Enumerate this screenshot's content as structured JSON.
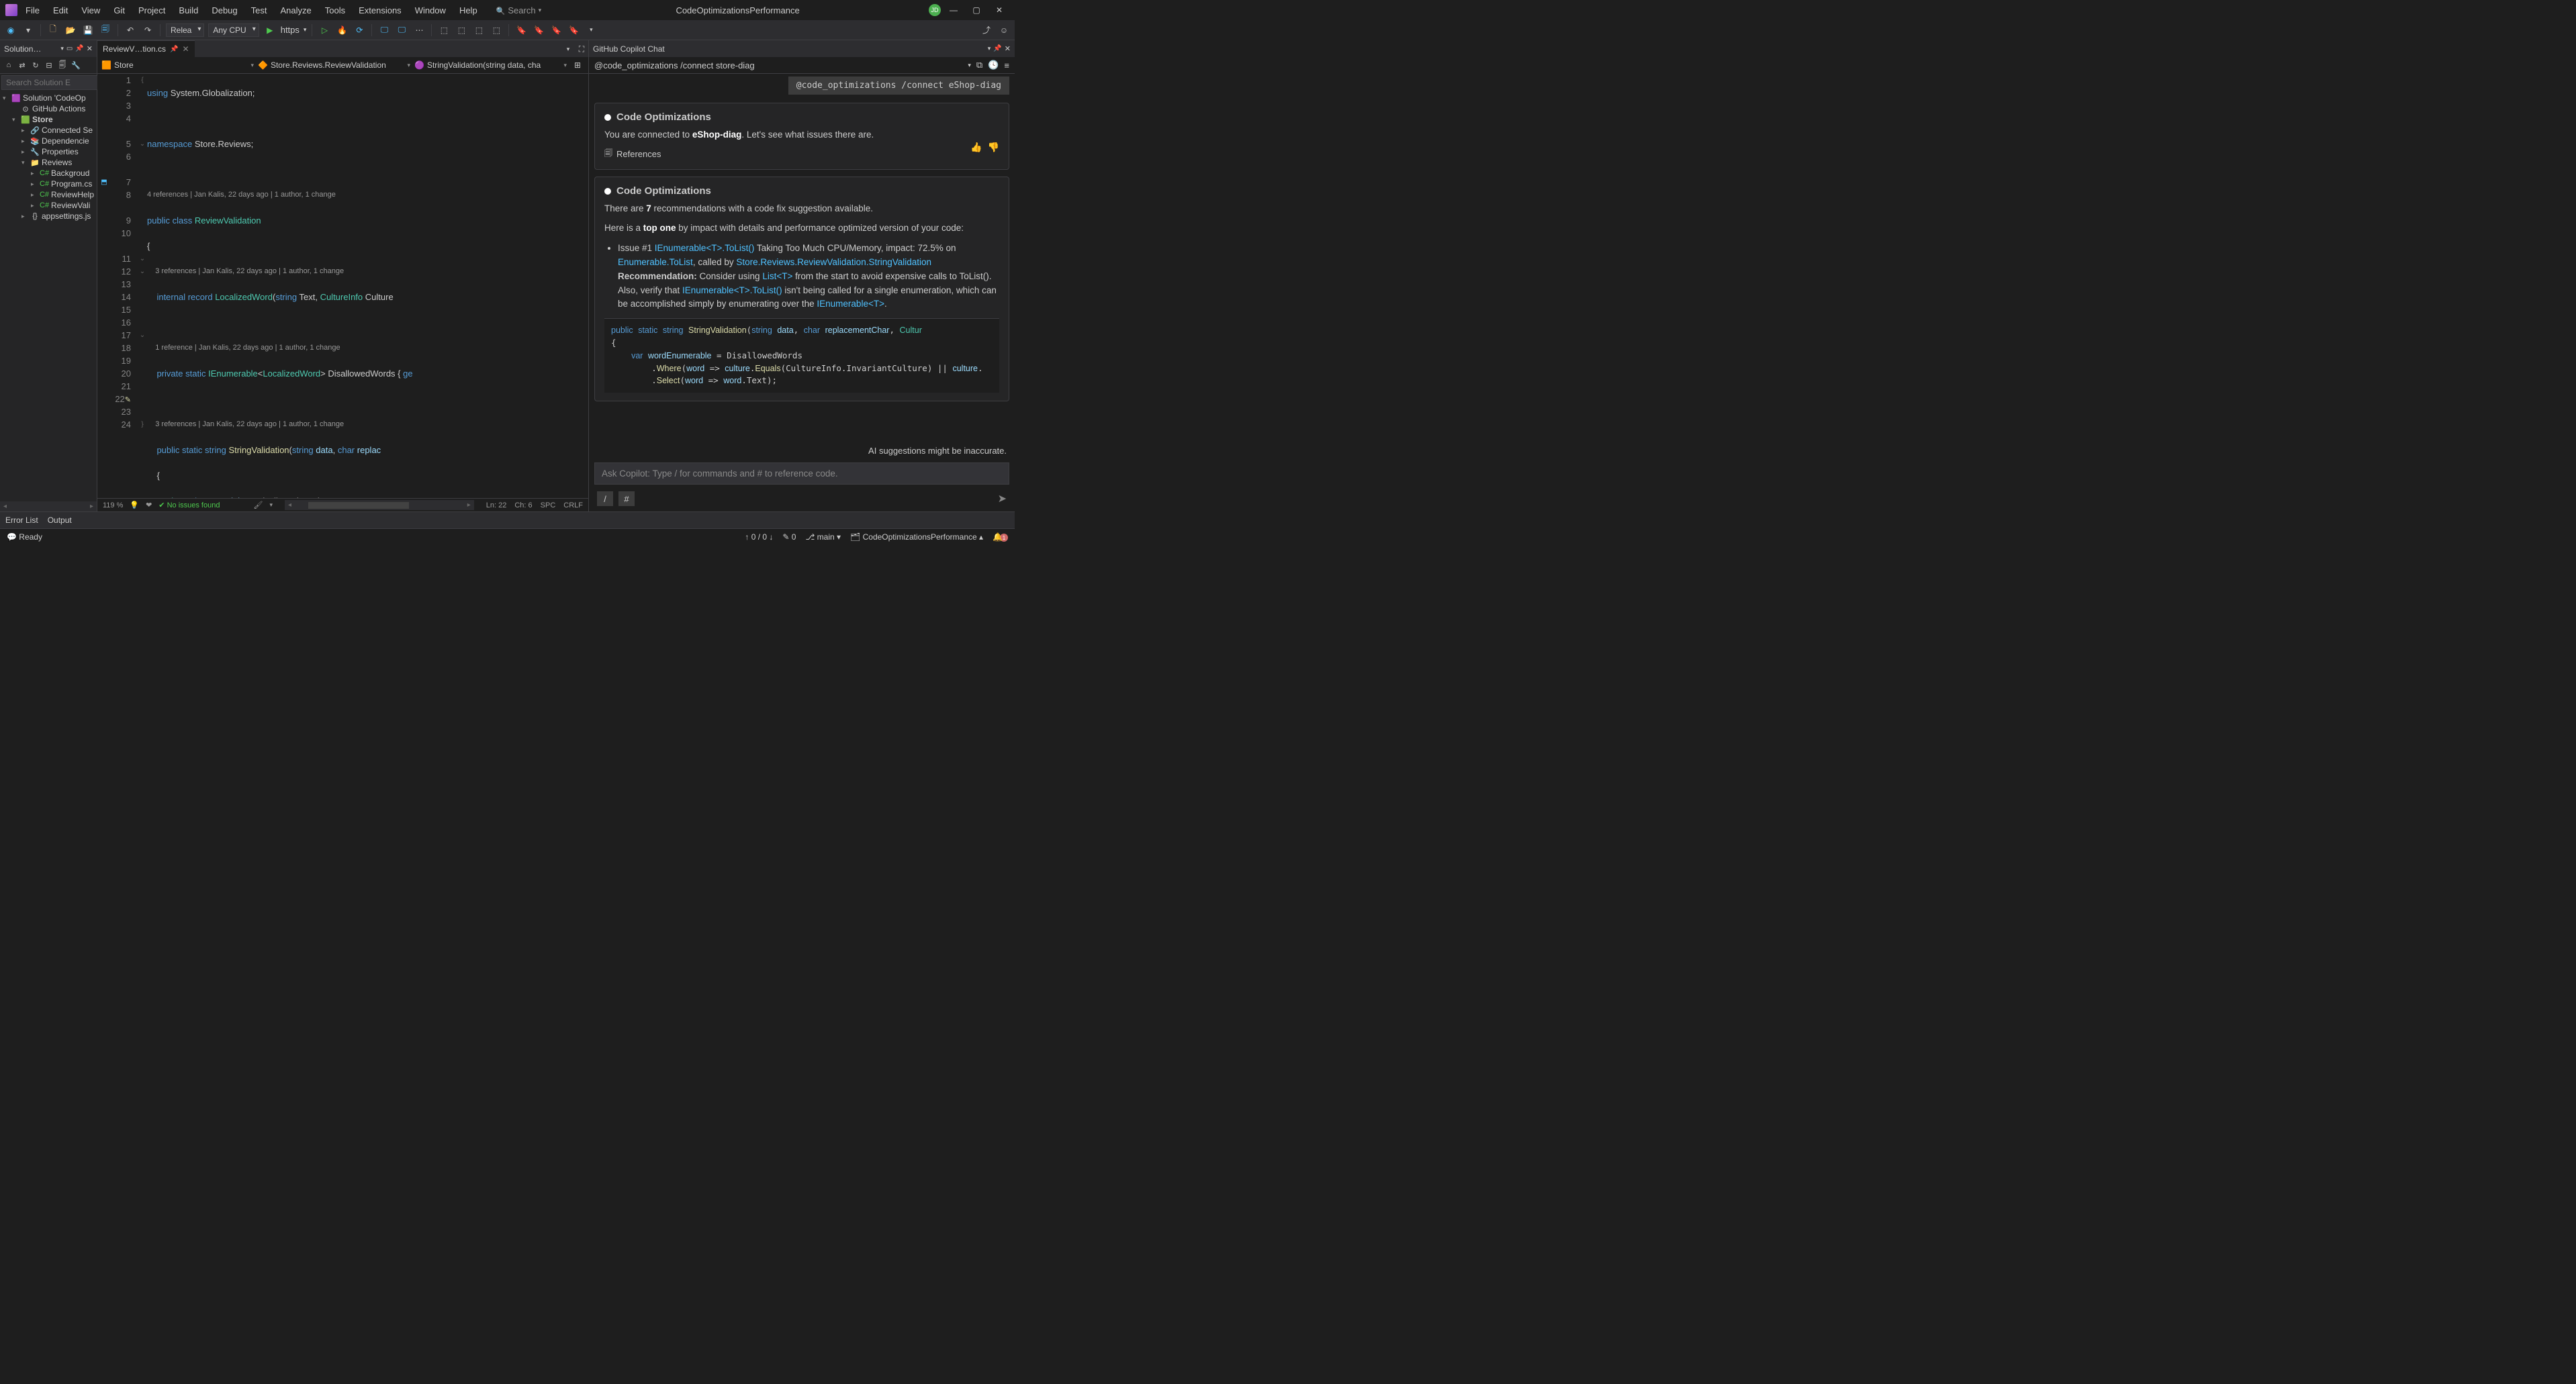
{
  "titlebar": {
    "menus": [
      "File",
      "Edit",
      "View",
      "Git",
      "Project",
      "Build",
      "Debug",
      "Test",
      "Analyze",
      "Tools",
      "Extensions",
      "Window",
      "Help"
    ],
    "search_placeholder": "Search",
    "app_title": "CodeOptimizationsPerformance",
    "avatar": "JD"
  },
  "toolbar": {
    "config": "Relea",
    "platform": "Any CPU",
    "launch": "https"
  },
  "solution": {
    "panel_title": "Solution…",
    "search_placeholder": "Search Solution E",
    "items": [
      {
        "indent": 0,
        "expander": "▾",
        "icon": "🟪",
        "label": "Solution 'CodeOp",
        "bold": false
      },
      {
        "indent": 1,
        "expander": "",
        "icon": "⊙",
        "label": "GitHub Actions",
        "bold": false
      },
      {
        "indent": 1,
        "expander": "▾",
        "icon": "🟩",
        "label": "Store",
        "bold": true
      },
      {
        "indent": 2,
        "expander": "▸",
        "icon": "🔗",
        "label": "Connected Se",
        "bold": false
      },
      {
        "indent": 2,
        "expander": "▸",
        "icon": "📚",
        "label": "Dependencie",
        "bold": false
      },
      {
        "indent": 2,
        "expander": "▸",
        "icon": "🔧",
        "label": "Properties",
        "bold": false
      },
      {
        "indent": 2,
        "expander": "▾",
        "icon": "📁",
        "label": "Reviews",
        "bold": false
      },
      {
        "indent": 3,
        "expander": "▸",
        "icon": "C#",
        "label": "Backgroud",
        "bold": false
      },
      {
        "indent": 3,
        "expander": "▸",
        "icon": "C#",
        "label": "Program.cs",
        "bold": false
      },
      {
        "indent": 3,
        "expander": "▸",
        "icon": "C#",
        "label": "ReviewHelp",
        "bold": false
      },
      {
        "indent": 3,
        "expander": "▸",
        "icon": "C#",
        "label": "ReviewVali",
        "bold": false
      },
      {
        "indent": 2,
        "expander": "▸",
        "icon": "{}",
        "label": "appsettings.js",
        "bold": false
      }
    ]
  },
  "editor": {
    "tab_name": "ReviewV…tion.cs",
    "breadcrumbs": {
      "project": "Store",
      "class": "Store.Reviews.ReviewValidation",
      "method": "StringValidation(string data, cha"
    },
    "status": {
      "zoom": "119 %",
      "issues": "No issues found",
      "ln": "Ln: 22",
      "ch": "Ch: 6",
      "spc": "SPC",
      "crlf": "CRLF"
    },
    "line_numbers": [
      "1",
      "2",
      "3",
      "4",
      "5",
      "6",
      "7",
      "8",
      "9",
      "10",
      "11",
      "12",
      "13",
      "14",
      "15",
      "16",
      "17",
      "18",
      "19",
      "20",
      "21",
      "22",
      "23",
      "24"
    ],
    "codelens": {
      "l5": "4 references | Jan Kalis, 22 days ago | 1 author, 1 change",
      "l7": "3 references | Jan Kalis, 22 days ago | 1 author, 1 change",
      "l9": "1 reference | Jan Kalis, 22 days ago | 1 author, 1 change",
      "l11": "3 references | Jan Kalis, 22 days ago | 1 author, 1 change"
    }
  },
  "copilot": {
    "panel_title": "GitHub Copilot Chat",
    "connect_top": "@code_optimizations /connect store-diag",
    "connect_pill": "@code_optimizations /connect eShop-diag",
    "card1": {
      "title": "Code Optimizations",
      "text_prefix": "You are connected to ",
      "target": "eShop-diag",
      "text_suffix": ". Let's see what issues there are.",
      "refs": "References"
    },
    "card2": {
      "title": "Code Optimizations",
      "rec_prefix": "There are ",
      "rec_count": "7",
      "rec_suffix": " recommendations with a code fix suggestion available.",
      "top_prefix": "Here is a ",
      "top_bold": "top one",
      "top_suffix": " by impact with details and performance optimized version of your code:",
      "issue_label": "Issue #1 ",
      "issue_link1": "IEnumerable<T>.ToList()",
      "issue_text1": " Taking Too Much CPU/Memory, impact: 72.5% on ",
      "issue_link2": "Enumerable.ToList",
      "issue_text2": ", called by ",
      "issue_link3": "Store.Reviews.ReviewValidation.StringValidation",
      "rec_label": "Recommendation: ",
      "rec_text1": "Consider using ",
      "rec_link1": "List<T>",
      "rec_text2": " from the start to avoid expensive calls to ToList(). Also, verify that ",
      "rec_link2": "IEnumerable<T>.ToList()",
      "rec_text3": " isn't being called for a single enumeration, which can be accomplished simply by enumerating over the ",
      "rec_link3": "IEnumerable<T>",
      "rec_text4": "."
    },
    "disclaimer": "AI suggestions might be inaccurate.",
    "input_placeholder": "Ask Copilot: Type / for commands and # to reference code.",
    "slash": "/",
    "hash": "#"
  },
  "bottom_tabs": [
    "Error List",
    "Output"
  ],
  "statusbar": {
    "ready": "Ready",
    "arrows": "↑ 0 / 0 ↓",
    "pencil": "✎ 0",
    "branch": "main",
    "project": "CodeOptimizationsPerformance",
    "bell_count": "1"
  }
}
